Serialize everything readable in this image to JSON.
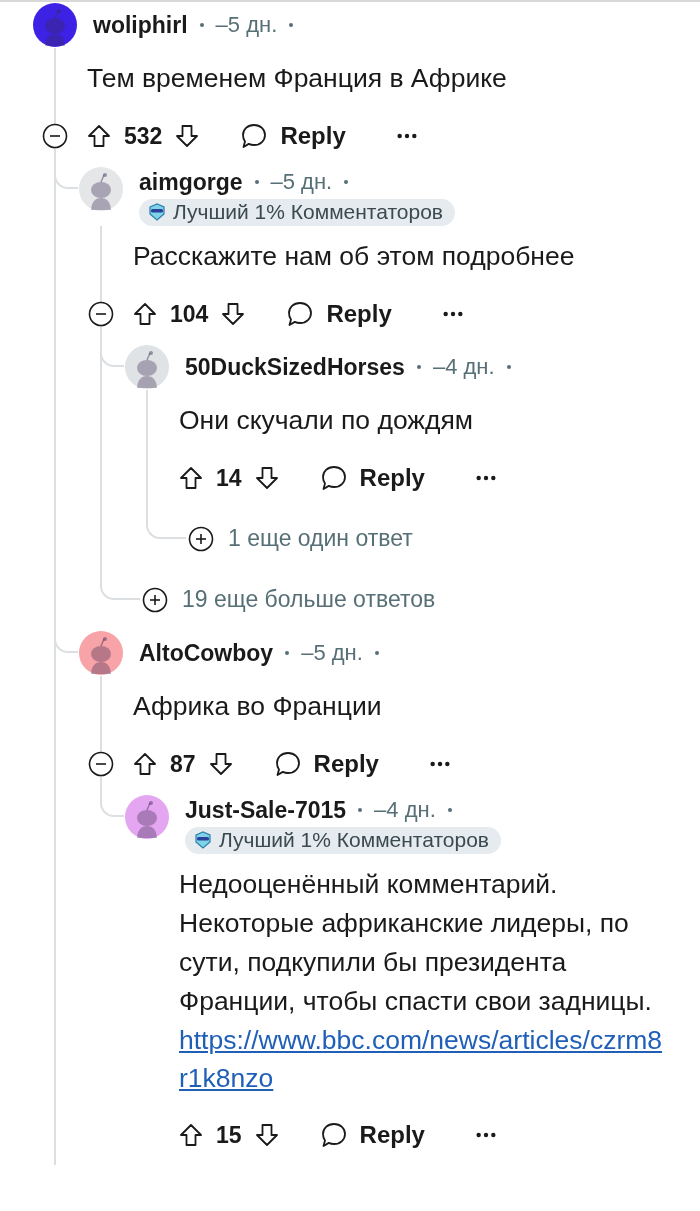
{
  "comments": [
    {
      "author": "woliphirl",
      "time": "–5 дн.",
      "color": "#3d22e6",
      "body": "Тем временем Франция в Африке",
      "score": "532",
      "reply": "Reply",
      "thread_continues": true,
      "children": [
        {
          "author": "aimgorge",
          "time": "–5 дн.",
          "color": "#e4e6e8",
          "badge": "Лучший 1% Комментаторов",
          "body": "Расскажите нам об этом подробнее",
          "score": "104",
          "reply": "Reply",
          "more": "19 еще больше ответов",
          "children": [
            {
              "author": "50DuckSizedHorses",
              "time": "–4 дн.",
              "color": "#dfe3e6",
              "body": "Они скучали по дождям",
              "score": "14",
              "reply": "Reply",
              "more": "1 еще один ответ"
            }
          ]
        },
        {
          "author": "AltoCowboy",
          "time": "–5 дн.",
          "color": "#f7a3a8",
          "body": "Африка во Франции",
          "score": "87",
          "reply": "Reply",
          "children": [
            {
              "author": "Just-Sale-7015",
              "time": "–4 дн.",
              "color": "#e4a6f0",
              "badge": "Лучший 1% Комментаторов",
              "body": "Недооценённый комментарий. Некоторые африканские лидеры, по сути, подкупили бы президента Франции, чтобы спасти свои задницы.",
              "link": "https://www.bbc.com/news/articles/czrm8r1k8nzo",
              "score": "15",
              "reply": "Reply"
            }
          ]
        }
      ]
    }
  ]
}
